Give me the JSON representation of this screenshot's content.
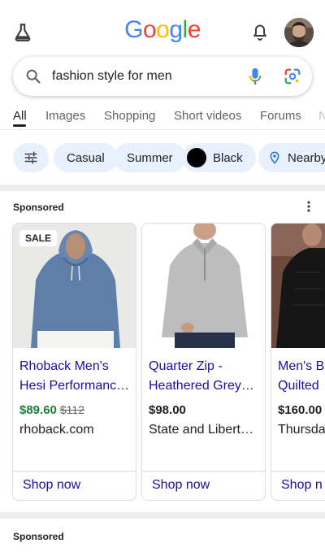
{
  "header": {
    "logo_letters": [
      {
        "ch": "G",
        "color": "#4285F4"
      },
      {
        "ch": "o",
        "color": "#EA4335"
      },
      {
        "ch": "o",
        "color": "#FBBC05"
      },
      {
        "ch": "g",
        "color": "#4285F4"
      },
      {
        "ch": "l",
        "color": "#34A853"
      },
      {
        "ch": "e",
        "color": "#EA4335"
      }
    ],
    "left_icon": "lab-flask-icon",
    "notification_icon": "bell-icon",
    "avatar": "user-avatar"
  },
  "search": {
    "query": "fashion style for men",
    "icons": [
      "search-icon",
      "mic-icon",
      "lens-icon"
    ]
  },
  "tabs": [
    {
      "label": "All",
      "active": true
    },
    {
      "label": "Images",
      "active": false
    },
    {
      "label": "Shopping",
      "active": false
    },
    {
      "label": "Short videos",
      "active": false
    },
    {
      "label": "Forums",
      "active": false
    },
    {
      "label": "N",
      "active": false
    }
  ],
  "chips": [
    {
      "label": "",
      "icon": "tune-icon"
    },
    {
      "label": "Casual"
    },
    {
      "label": "Summer"
    },
    {
      "label": "Black",
      "swatch_color": "#000000"
    },
    {
      "label": "Nearby",
      "icon": "location-pin-icon"
    }
  ],
  "sponsored_label": "Sponsored",
  "products": [
    {
      "title_line1": "Rhoback Men's",
      "title_line2": "Hesi Performanc…",
      "badge": "SALE",
      "price": "$89.60",
      "original_price": "$112",
      "store": "rhoback.com",
      "cta": "Shop now"
    },
    {
      "title_line1": "Quarter Zip -",
      "title_line2": "Heathered Grey…",
      "price": "$98.00",
      "store": "State and Libert…",
      "cta": "Shop now"
    },
    {
      "title_line1": "Men's B",
      "title_line2": "Quilted",
      "price": "$160.00",
      "store": "Thursda",
      "cta": "Shop n"
    }
  ],
  "sponsored_label_2": "Sponsored",
  "colors": {
    "link": "#1a0dab",
    "sale_price": "#188038",
    "chip_bg": "#e8f0fe"
  }
}
